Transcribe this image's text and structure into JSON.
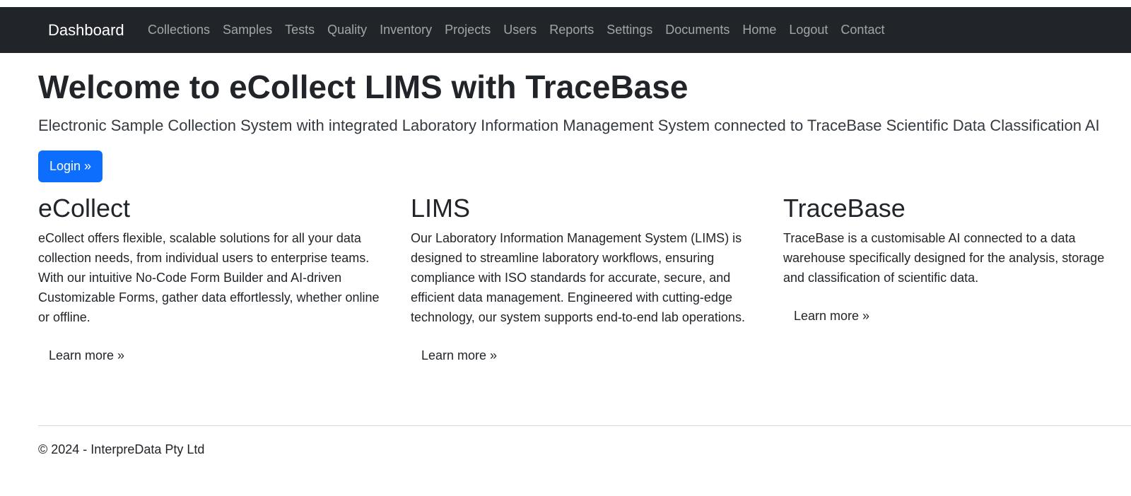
{
  "navbar": {
    "brand": "Dashboard",
    "links": [
      "Collections",
      "Samples",
      "Tests",
      "Quality",
      "Inventory",
      "Projects",
      "Users",
      "Reports",
      "Settings",
      "Documents",
      "Home",
      "Logout",
      "Contact"
    ]
  },
  "hero": {
    "title": "Welcome to eCollect LIMS with TraceBase",
    "lead": "Electronic Sample Collection System with integrated Laboratory Information Management System connected to TraceBase Scientific Data Classification AI",
    "login_label": "Login »"
  },
  "columns": [
    {
      "heading": "eCollect",
      "body": "eCollect offers flexible, scalable solutions for all your data collection needs, from individual users to enterprise teams. With our intuitive No-Code Form Builder and AI-driven Customizable Forms, gather data effortlessly, whether online or offline.",
      "link_label": "Learn more »"
    },
    {
      "heading": "LIMS",
      "body": "Our Laboratory Information Management System (LIMS) is designed to streamline laboratory workflows, ensuring compliance with ISO standards for accurate, secure, and efficient data management. Engineered with cutting-edge technology, our system supports end-to-end lab operations.",
      "link_label": "Learn more »"
    },
    {
      "heading": "TraceBase",
      "body": "TraceBase is a customisable AI connected to a data warehouse specifically designed for the analysis, storage and classification of scientific data.",
      "link_label": "Learn more »"
    }
  ],
  "footer": {
    "copyright": "© 2024 - InterpreData Pty Ltd"
  }
}
